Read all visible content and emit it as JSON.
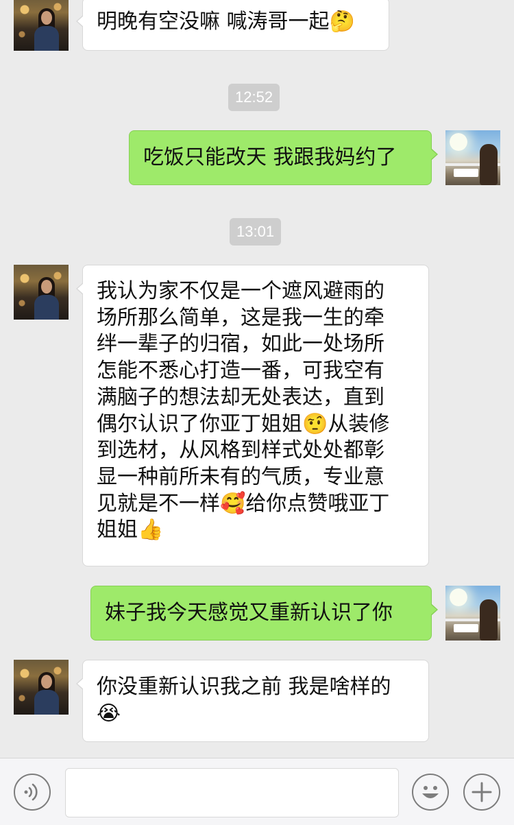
{
  "messages": [
    {
      "side": "in",
      "text": "明晚有空没嘛 喊涛哥一起🤔"
    },
    {
      "time": "12:52"
    },
    {
      "side": "out",
      "text": "吃饭只能改天 我跟我妈约了"
    },
    {
      "time": "13:01"
    },
    {
      "side": "in",
      "lines": [
        "我认为家不仅是一个遮风避雨的",
        "场所那么简单，这是我一生的牵",
        "绊一辈子的归宿，如此一处场所",
        "怎能不悉心打造一番，可我空有",
        "满脑子的想法却无处表达，直到",
        "偶尔认识了你亚丁姐姐🤨从装修",
        "到选材，从风格到样式处处都彰",
        "显一种前所未有的气质，专业意",
        "见就是不一样🥰给你点赞哦亚丁",
        "姐姐👍"
      ]
    },
    {
      "side": "out",
      "text": "妹子我今天感觉又重新认识了你"
    },
    {
      "side": "in",
      "lines": [
        "你没重新认识我之前 我是啥样的",
        "😭"
      ]
    }
  ],
  "input": {
    "voice_icon": "voice-icon",
    "emoji_icon": "emoji-icon",
    "plus_icon": "plus-icon",
    "value": ""
  },
  "colors": {
    "background": "#ebebeb",
    "incoming_bubble": "#ffffff",
    "outgoing_bubble": "#9eea6a",
    "timestamp_bg": "#cecece"
  }
}
